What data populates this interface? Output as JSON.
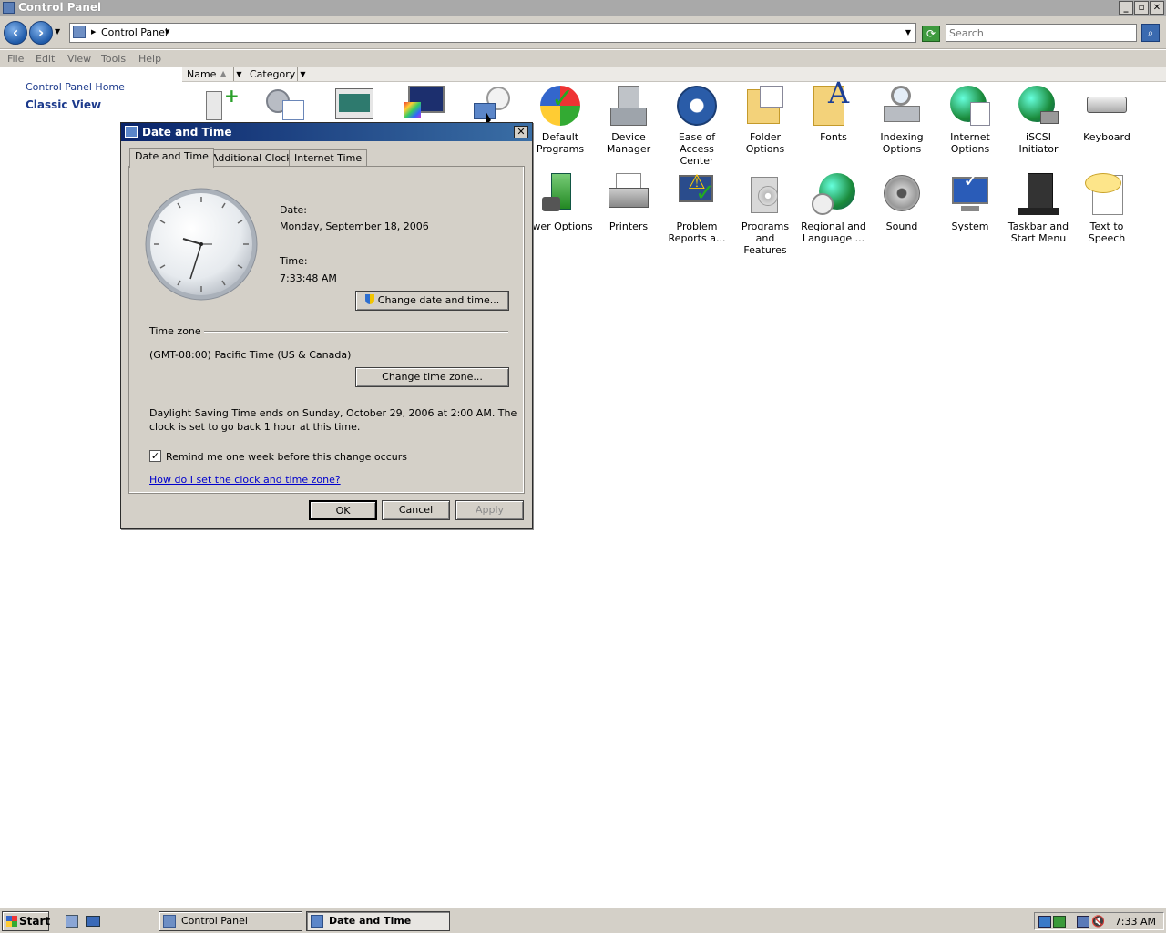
{
  "window": {
    "title": "Control Panel"
  },
  "address": {
    "path": "Control Panel",
    "search_placeholder": "Search"
  },
  "menu": [
    "File",
    "Edit",
    "View",
    "Tools",
    "Help"
  ],
  "left_pane": {
    "home": "Control Panel Home",
    "classic": "Classic View"
  },
  "columns": {
    "name": "Name",
    "category": "Category"
  },
  "icons_row1": [
    {
      "l1": "Default",
      "l2": "Programs"
    },
    {
      "l1": "Device",
      "l2": "Manager"
    },
    {
      "l1": "Ease of",
      "l2": "Access Center"
    },
    {
      "l1": "Folder Options",
      "l2": ""
    },
    {
      "l1": "Fonts",
      "l2": ""
    },
    {
      "l1": "Indexing",
      "l2": "Options"
    },
    {
      "l1": "Internet",
      "l2": "Options"
    },
    {
      "l1": "iSCSI Initiator",
      "l2": ""
    },
    {
      "l1": "Keyboard",
      "l2": ""
    }
  ],
  "icons_row2": [
    {
      "l1": "Power Options",
      "l2": ""
    },
    {
      "l1": "Printers",
      "l2": ""
    },
    {
      "l1": "Problem",
      "l2": "Reports a..."
    },
    {
      "l1": "Programs and",
      "l2": "Features"
    },
    {
      "l1": "Regional and",
      "l2": "Language ..."
    },
    {
      "l1": "Sound",
      "l2": ""
    },
    {
      "l1": "System",
      "l2": ""
    },
    {
      "l1": "Taskbar and",
      "l2": "Start Menu"
    },
    {
      "l1": "Text to",
      "l2": "Speech"
    }
  ],
  "dialog": {
    "title": "Date and Time",
    "tabs": [
      "Date and Time",
      "Additional Clocks",
      "Internet Time"
    ],
    "date_label": "Date:",
    "date_value": "Monday, September 18, 2006",
    "time_label": "Time:",
    "time_value": "7:33:48 AM",
    "change_datetime": "Change date and time...",
    "timezone_heading": "Time zone",
    "timezone_value": "(GMT-08:00) Pacific Time (US & Canada)",
    "change_timezone": "Change time zone...",
    "dst_line1": "Daylight Saving Time ends on Sunday, October 29, 2006 at 2:00 AM. The",
    "dst_line2": "clock is set to go back 1 hour at this time.",
    "remind": "Remind me one week before this change occurs",
    "help_link": "How do I set the clock and time zone?",
    "ok": "OK",
    "cancel": "Cancel",
    "apply": "Apply"
  },
  "taskbar": {
    "start": "Start",
    "tasks": [
      "Control Panel",
      "Date and Time"
    ],
    "clock": "7:33 AM"
  }
}
